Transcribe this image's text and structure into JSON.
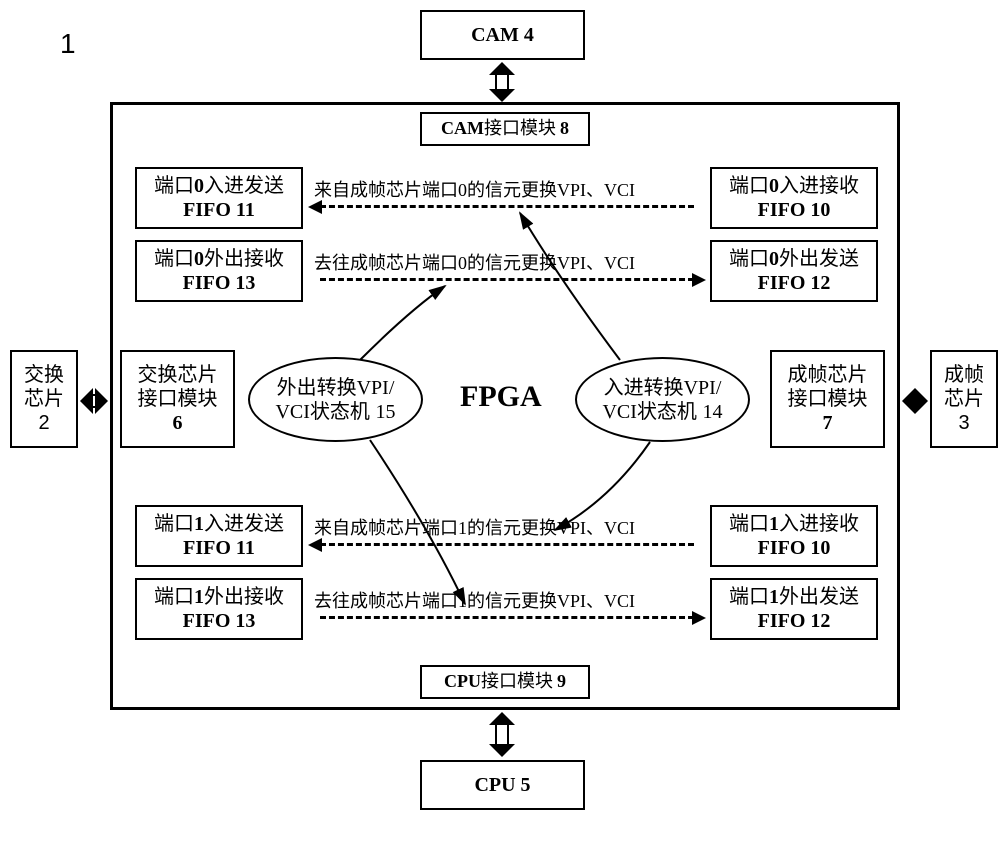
{
  "num1": "1",
  "cam": {
    "label": "CAM 4"
  },
  "cpu": {
    "label": "CPU 5"
  },
  "exchangeChip": {
    "line1": "交换",
    "line2": "芯片",
    "num": "2"
  },
  "framingChip": {
    "line1": "成帧",
    "line2": "芯片",
    "num": "3"
  },
  "camInterface": {
    "prefix": "CAM",
    "label": "接口模块",
    "num": "8"
  },
  "cpuInterface": {
    "prefix": "CPU",
    "label": "接口模块",
    "num": "9"
  },
  "exchangeInterface": {
    "line1": "交换芯片",
    "line2": "接口模块",
    "num": "6"
  },
  "framingInterface": {
    "line1": "成帧芯片",
    "line2": "接口模块",
    "num": "7"
  },
  "fpga": "FPGA",
  "sm_out": {
    "line1": "外出转换",
    "vpi": "VPI/",
    "line2": "VCI",
    "label": "状态机",
    "num": "15"
  },
  "sm_in": {
    "line1": "入进转换",
    "vpi": "VPI/",
    "line2": "VCI",
    "label": "状态机",
    "num": "14"
  },
  "port0": {
    "inSend": {
      "line1": "端口",
      "pnum": "0",
      "suffix": "入进发送",
      "fifo": "FIFO 11"
    },
    "outRecv": {
      "line1": "端口",
      "pnum": "0",
      "suffix": "外出接收",
      "fifo": "FIFO 13"
    },
    "inRecv": {
      "line1": "端口",
      "pnum": "0",
      "suffix": "入进接收",
      "fifo": "FIFO 10"
    },
    "outSend": {
      "line1": "端口",
      "pnum": "0",
      "suffix": "外出发送",
      "fifo": "FIFO 12"
    }
  },
  "port1": {
    "inSend": {
      "line1": "端口",
      "pnum": "1",
      "suffix": "入进发送",
      "fifo": "FIFO 11"
    },
    "outRecv": {
      "line1": "端口",
      "pnum": "1",
      "suffix": "外出接收",
      "fifo": "FIFO 13"
    },
    "inRecv": {
      "line1": "端口",
      "pnum": "1",
      "suffix": "入进接收",
      "fifo": "FIFO 10"
    },
    "outSend": {
      "line1": "端口",
      "pnum": "1",
      "suffix": "外出发送",
      "fifo": "FIFO 12"
    }
  },
  "dashed": {
    "p0_in": {
      "pre": "来自成帧芯片端口",
      "n": "0",
      "mid": "的信元更换",
      "v": "VPI",
      "sep": "、",
      "c": "VCI"
    },
    "p0_out": {
      "pre": "去往成帧芯片端口",
      "n": "0",
      "mid": "的信元更换",
      "v": "VPI",
      "sep": "、",
      "c": "VCI"
    },
    "p1_in": {
      "pre": "来自成帧芯片端口",
      "n": "1",
      "mid": "的信元更换",
      "v": "VPI",
      "sep": "、",
      "c": "VCI"
    },
    "p1_out": {
      "pre": "去往成帧芯片端口",
      "n": "1",
      "mid": "的信元更换",
      "v": "VPI",
      "sep": "、",
      "c": "VCI"
    }
  }
}
